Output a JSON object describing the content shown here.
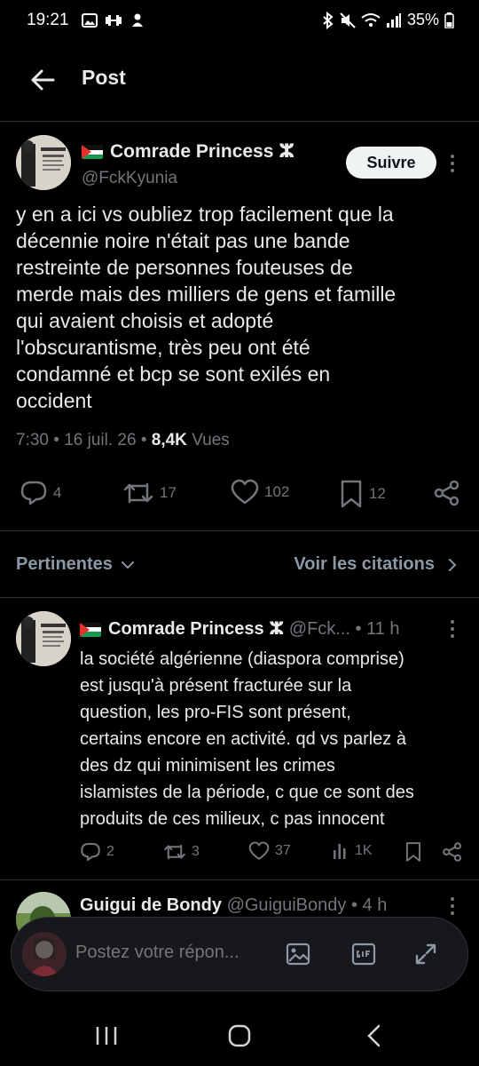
{
  "status": {
    "time": "19:21",
    "battery": "35%"
  },
  "header": {
    "title": "Post"
  },
  "main_post": {
    "name": "Comrade Princess ⵣ",
    "handle": "@FckKyunia",
    "follow_label": "Suivre",
    "text": "y en a ici vs oubliez trop facilement que la\ndécennie noire n'était pas une bande\nrestreinte de personnes fouteuses de\nmerde mais des milliers de gens et famille\nqui avaient choisis et adopté\nl'obscurantisme, très peu ont été\ncondamné et bcp se sont exilés en\noccident",
    "time": "7:30",
    "date": "16 juil. 26",
    "views_count": "8,4K",
    "views_label": "Vues",
    "replies": "4",
    "reposts": "17",
    "likes": "102",
    "bookmarks": "12"
  },
  "filters": {
    "sort_label": "Pertinentes",
    "quotes_label": "Voir les citations"
  },
  "replies": [
    {
      "name": "Comrade Princess ⵣ",
      "handle": "@Fck...",
      "age": "11 h",
      "text": "la société algérienne (diaspora comprise)\nest jusqu'à présent fracturée sur la\nquestion, les pro-FIS sont présent,\ncertains encore en activité. qd vs parlez à\ndes dz qui minimisent les crimes\nislamistes de la période, c que ce sont des\nproduits de ces milieux, c pas innocent",
      "replies": "2",
      "reposts": "3",
      "likes": "37",
      "views": "1K"
    },
    {
      "name": "Guigui de Bondy",
      "handle": "@GuiguiBondy",
      "age": "4 h"
    }
  ],
  "composer": {
    "placeholder": "Postez votre répon..."
  },
  "colors": {
    "background": "#000000",
    "text": "#e7e9ea",
    "muted": "#71767b",
    "button": "#eff3f4"
  }
}
